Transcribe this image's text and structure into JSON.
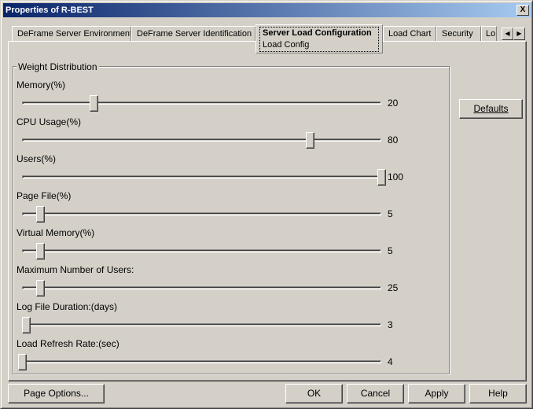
{
  "window": {
    "title": "Properties of R-BEST",
    "close_label": "X"
  },
  "tabs": [
    {
      "label": "DeFrame Server Environment"
    },
    {
      "label": "DeFrame Server Identification"
    },
    {
      "label": "Server Load Configuration",
      "sublabel": "Load Config",
      "active": true
    },
    {
      "label": "Load Chart"
    },
    {
      "label": "Security"
    },
    {
      "label": "Lo"
    }
  ],
  "group": {
    "title": "Weight Distribution"
  },
  "sliders": [
    {
      "label": "Memory(%)",
      "value": "20",
      "fraction": 0.2
    },
    {
      "label": "CPU Usage(%)",
      "value": "80",
      "fraction": 0.8
    },
    {
      "label": "Users(%)",
      "value": "100",
      "fraction": 1.0
    },
    {
      "label": "Page File(%)",
      "value": "5",
      "fraction": 0.05
    },
    {
      "label": "Virtual Memory(%)",
      "value": "5",
      "fraction": 0.05
    },
    {
      "label": "Maximum Number of Users:",
      "value": "25",
      "fraction": 0.05
    },
    {
      "label": "Log File Duration:(days)",
      "value": "3",
      "fraction": 0.01
    },
    {
      "label": "Load Refresh Rate:(sec)",
      "value": "4",
      "fraction": 0.0
    }
  ],
  "buttons": {
    "defaults": "Defaults",
    "page_options": "Page Options...",
    "ok": "OK",
    "cancel": "Cancel",
    "apply": "Apply",
    "help": "Help"
  }
}
